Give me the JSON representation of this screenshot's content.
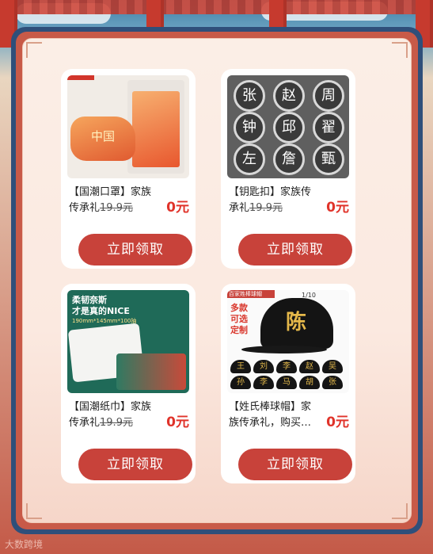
{
  "cards": [
    {
      "name": "【国潮口罩】家族",
      "line2_text": "传承礼",
      "orig_price": "19.9元",
      "price": "0元",
      "button": "立即领取"
    },
    {
      "name": "【钥匙扣】家族传",
      "line2_text": "承礼",
      "orig_price": "19.9元",
      "price": "0元",
      "button": "立即领取"
    },
    {
      "name": "【国潮纸巾】家族",
      "line2_text": "传承礼",
      "orig_price": "19.9元",
      "price": "0元",
      "button": "立即领取"
    },
    {
      "name": "【姓氏棒球帽】家",
      "line2_text": "族传承礼，购买…",
      "orig_price": "",
      "price": "0元",
      "button": "立即领取"
    }
  ],
  "keychain_chars": [
    "张",
    "赵",
    "周",
    "钟",
    "邱",
    "翟",
    "左",
    "詹",
    "甄"
  ],
  "tissue_ad": {
    "line1": "柔韧奈斯",
    "line2": "才是真的NICE",
    "size": "190mm*145mm*100抽"
  },
  "cap_ad": {
    "banner": "百家姓棒球帽",
    "tag1": "多款",
    "tag2": "可选",
    "tag3": "定制",
    "big_char": "陈",
    "page": "1/10"
  },
  "cap_small_chars": [
    "王",
    "刘",
    "李",
    "赵",
    "吴",
    "孙",
    "李",
    "马",
    "胡",
    "张"
  ],
  "mask_text": "中国",
  "watermark": "大数跨境",
  "colors": {
    "button": "#c8423a",
    "price": "#e0332a",
    "frame_blue": "#2f4f7a"
  }
}
